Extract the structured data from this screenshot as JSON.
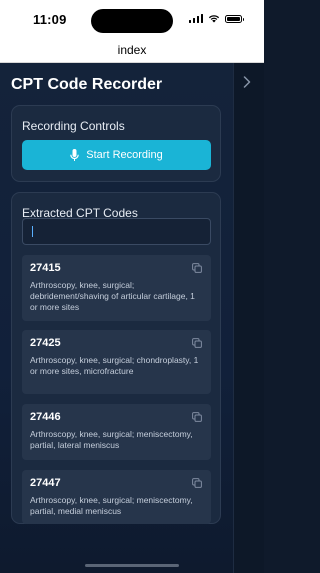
{
  "status_bar": {
    "time": "11:09"
  },
  "nav": {
    "title": "index"
  },
  "app": {
    "title": "CPT Code Recorder"
  },
  "recording": {
    "heading": "Recording Controls",
    "button_label": "Start Recording"
  },
  "codes": {
    "heading": "Extracted CPT Codes",
    "search_value": "",
    "items": [
      {
        "code": "27415",
        "description": "Arthroscopy, knee, surgical; debridement/shaving of articular cartilage, 1 or more sites"
      },
      {
        "code": "27425",
        "description": "Arthroscopy, knee, surgical; chondroplasty, 1 or more sites, microfracture"
      },
      {
        "code": "27446",
        "description": "Arthroscopy, knee, surgical; meniscectomy, partial, lateral meniscus"
      },
      {
        "code": "27447",
        "description": "Arthroscopy, knee, surgical; meniscectomy, partial, medial meniscus"
      }
    ]
  },
  "colors": {
    "accent": "#1ab4d6",
    "background": "#14233a",
    "card": "#1b2a40",
    "item": "#26354b"
  },
  "icons": [
    "wifi-icon",
    "battery-icon",
    "chevron-right-icon",
    "microphone-icon",
    "copy-icon"
  ]
}
